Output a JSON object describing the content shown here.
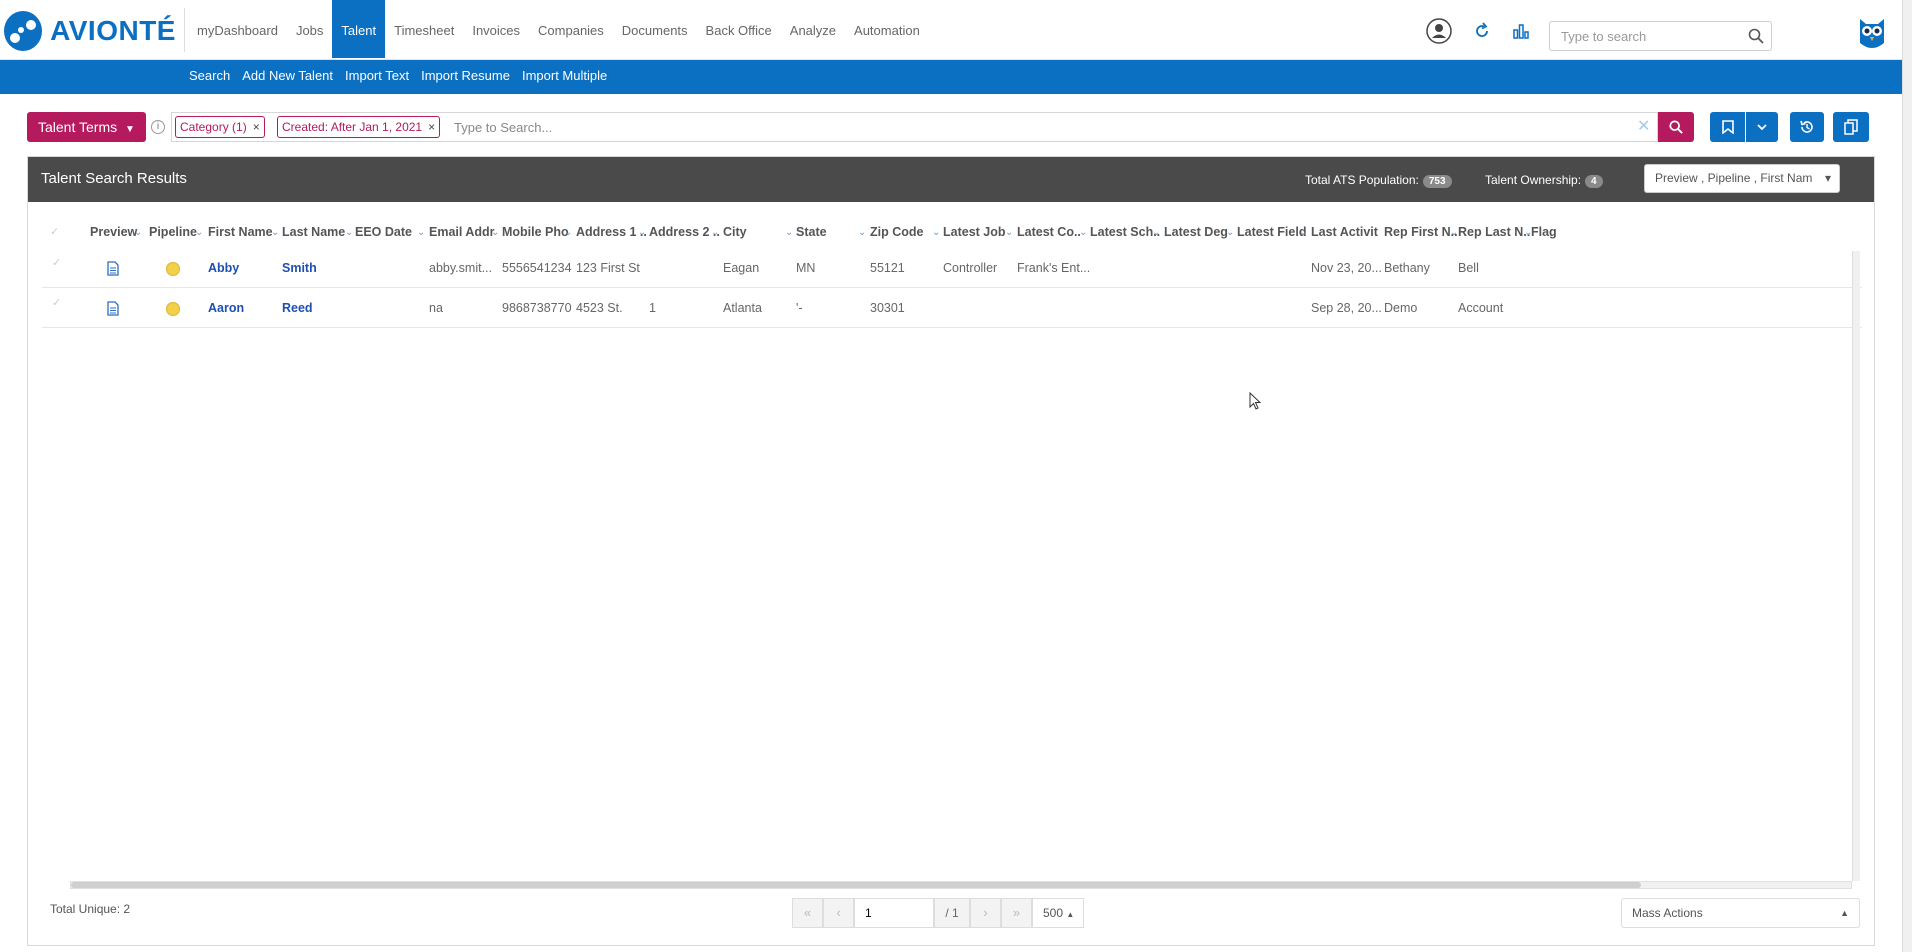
{
  "brand": {
    "name": "AVIONTÉ"
  },
  "nav": {
    "items": [
      "myDashboard",
      "Jobs",
      "Talent",
      "Timesheet",
      "Invoices",
      "Companies",
      "Documents",
      "Back Office",
      "Analyze",
      "Automation"
    ],
    "active": "Talent"
  },
  "header": {
    "search_placeholder": "Type to search",
    "icons": [
      "user-circle-icon",
      "refresh-icon",
      "bar-chart-icon",
      "search-icon",
      "owl-icon"
    ]
  },
  "subnav": {
    "items": [
      "Search",
      "Add New Talent",
      "Import Text",
      "Import Resume",
      "Import Multiple"
    ]
  },
  "search": {
    "terms_button": "Talent Terms",
    "chips": [
      {
        "label": "Category (1)"
      },
      {
        "label": "Created: After Jan 1, 2021"
      }
    ],
    "placeholder": "Type to Search..."
  },
  "results": {
    "title": "Talent Search Results",
    "ats_label": "Total ATS Population:",
    "ats_count": "753",
    "ownership_label": "Talent Ownership:",
    "ownership_count": "4",
    "columns_select": "Preview , Pipeline , First Nam",
    "columns": [
      "Preview",
      "Pipeline",
      "First Name",
      "Last Name",
      "EEO Date",
      "Email Addr",
      "Mobile Pho",
      "Address 1 ..",
      "Address 2 ..",
      "City",
      "State",
      "Zip Code",
      "Latest Job",
      "Latest Co..",
      "Latest Sch..",
      "Latest Deg",
      "Latest Field",
      "Last Activit",
      "Rep First N..",
      "Rep Last N..",
      "Flag"
    ],
    "rows": [
      {
        "first": "Abby",
        "last": "Smith",
        "eeo": "",
        "email": "abby.smit...",
        "mobile": "5556541234",
        "addr1": "123 First St",
        "addr2": "",
        "city": "Eagan",
        "state": "MN",
        "zip": "55121",
        "job": "Controller",
        "company": "Frank's Ent...",
        "school": "",
        "degree": "",
        "field": "",
        "activity": "Nov 23, 20...",
        "rep_first": "Bethany",
        "rep_last": "Bell"
      },
      {
        "first": "Aaron",
        "last": "Reed",
        "eeo": "",
        "email": "na",
        "mobile": "9868738770",
        "addr1": "4523 St.",
        "addr2": "1",
        "city": "Atlanta",
        "state": "'-",
        "zip": "30301",
        "job": "",
        "company": "",
        "school": "",
        "degree": "",
        "field": "",
        "activity": "Sep 28, 20...",
        "rep_first": "Demo",
        "rep_last": "Account"
      }
    ],
    "total_unique": "Total Unique: 2"
  },
  "pager": {
    "page": "1",
    "total": "/ 1",
    "size": "500"
  },
  "mass_actions": "Mass Actions",
  "colors": {
    "brand_blue": "#0b6fc2",
    "accent": "#b5195e",
    "header_dark": "#4a4a4a"
  }
}
